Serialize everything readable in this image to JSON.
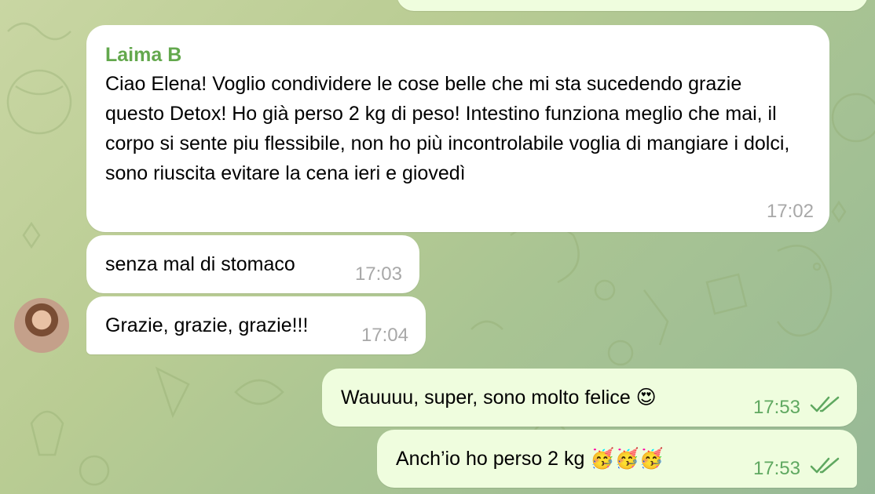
{
  "messages": {
    "m1": {
      "sender": "Laima B",
      "text": "Ciao Elena! Voglio condividere le cose belle che mi sta sucedendo grazie questo Detox! Ho già perso 2 kg di peso! Intestino funziona meglio che mai, il corpo si sente piu flessibile, non ho più incontrolabile voglia di mangiare i dolci, sono riuscita evitare la cena ieri e giovedì",
      "time": "17:02"
    },
    "m2": {
      "text": "senza mal di stomaco",
      "time": "17:03"
    },
    "m3": {
      "text": "Grazie, grazie, grazie!!!",
      "time": "17:04"
    },
    "m4": {
      "text": "Wauuuu, super, sono molto felice 😍",
      "time": "17:53",
      "status_icon": "double-check-icon"
    },
    "m5": {
      "text": "Anch’io ho perso 2 kg 🥳🥳🥳",
      "time": "17:53",
      "status_icon": "double-check-icon"
    }
  },
  "colors": {
    "sender": "#63a84d",
    "incoming_bubble": "#ffffff",
    "outgoing_bubble": "#effdde",
    "outgoing_time": "#5fa860",
    "incoming_time": "#a8a8a8"
  }
}
